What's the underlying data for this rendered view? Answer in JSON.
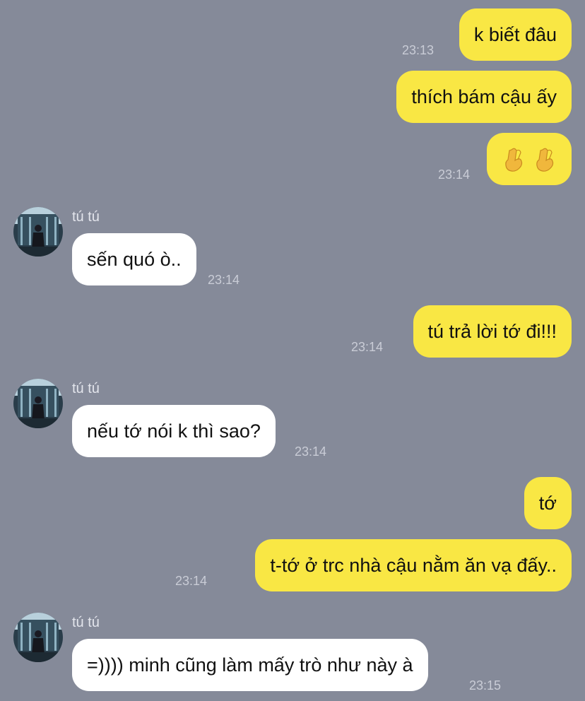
{
  "contact_name": "tú tú",
  "messages": [
    {
      "dir": "out",
      "text": "k biết đâu",
      "time": "23:13"
    },
    {
      "dir": "out",
      "text": "thích bám cậu ấy",
      "time": ""
    },
    {
      "dir": "out",
      "text": "🤞🤞",
      "time": "23:14"
    },
    {
      "dir": "in",
      "sender": "tú tú",
      "text": "sến quó ò..",
      "time": "23:14"
    },
    {
      "dir": "out",
      "text": "tú trả lời tớ đi!!!",
      "time": "23:14"
    },
    {
      "dir": "in",
      "sender": "tú tú",
      "text": "nếu tớ nói k thì sao?",
      "time": "23:14"
    },
    {
      "dir": "out",
      "text": "tớ",
      "time": ""
    },
    {
      "dir": "out",
      "text": "t-tớ ở trc nhà cậu nằm ăn vạ đấy..",
      "time": "23:14"
    },
    {
      "dir": "in",
      "sender": "tú tú",
      "text": "=)))) minh cũng làm mấy trò như này à",
      "time": "23:15"
    }
  ],
  "colors": {
    "background": "#858a99",
    "outgoing_bubble": "#f9e744",
    "incoming_bubble": "#ffffff",
    "timestamp": "#c9ccd6"
  },
  "icons": {
    "avatar": "user-avatar-photo",
    "emoji": "crossed-fingers-emoji"
  }
}
